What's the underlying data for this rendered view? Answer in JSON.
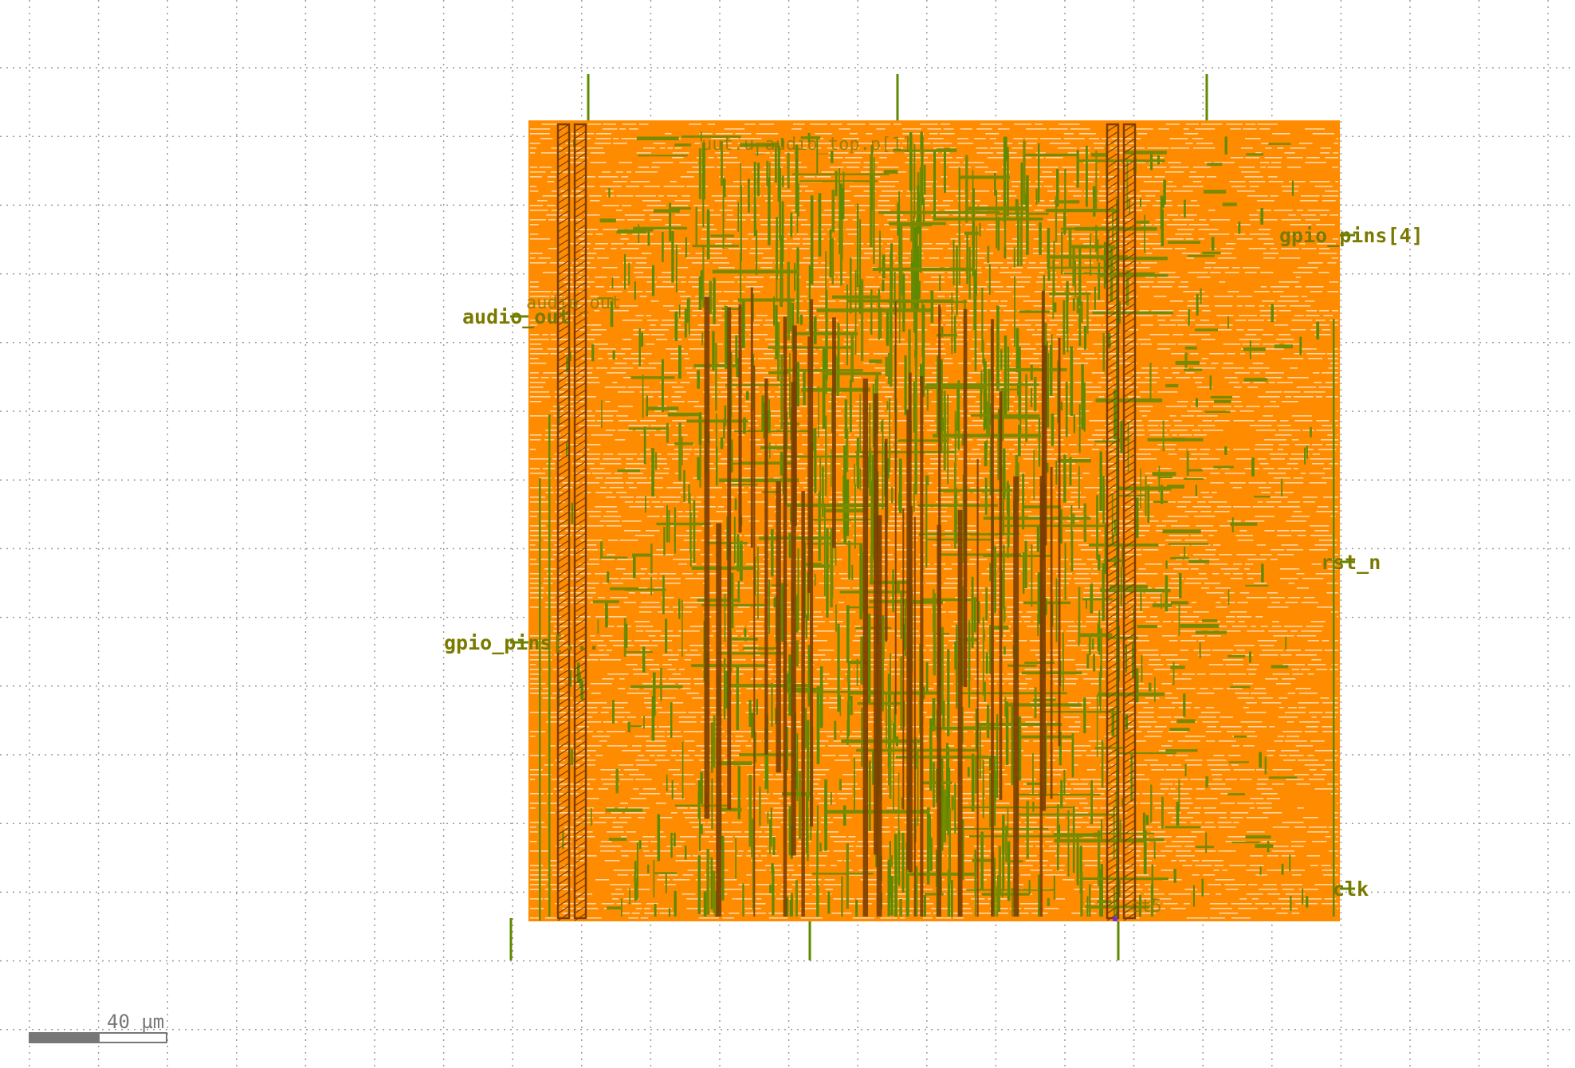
{
  "layout_view": {
    "pins": {
      "audio_out": "audio_out",
      "gpio_pins_left": "gpio_pins[...",
      "gpio_pins_4": "gpio_pins[4]",
      "rst_n": "rst_n",
      "clk": "clk"
    },
    "internal_labels": {
      "top_net": "uut.u_audio_top.p[1]",
      "audio_net": "audio_out",
      "bottom_net": "ct5"
    },
    "scale_bar": {
      "label": "40 µm"
    },
    "colors": {
      "background": "#ffffff",
      "grid": "#9a9a9a",
      "cell_fill": "#ff8c00",
      "cell_stripe": "#ffd7a6",
      "metal_route": "#5f8a00",
      "metal_dense": "#7a8a00",
      "power_strap": "#7a3f00",
      "pin_label": "#7a7a00",
      "scale_dark": "#777777"
    }
  }
}
